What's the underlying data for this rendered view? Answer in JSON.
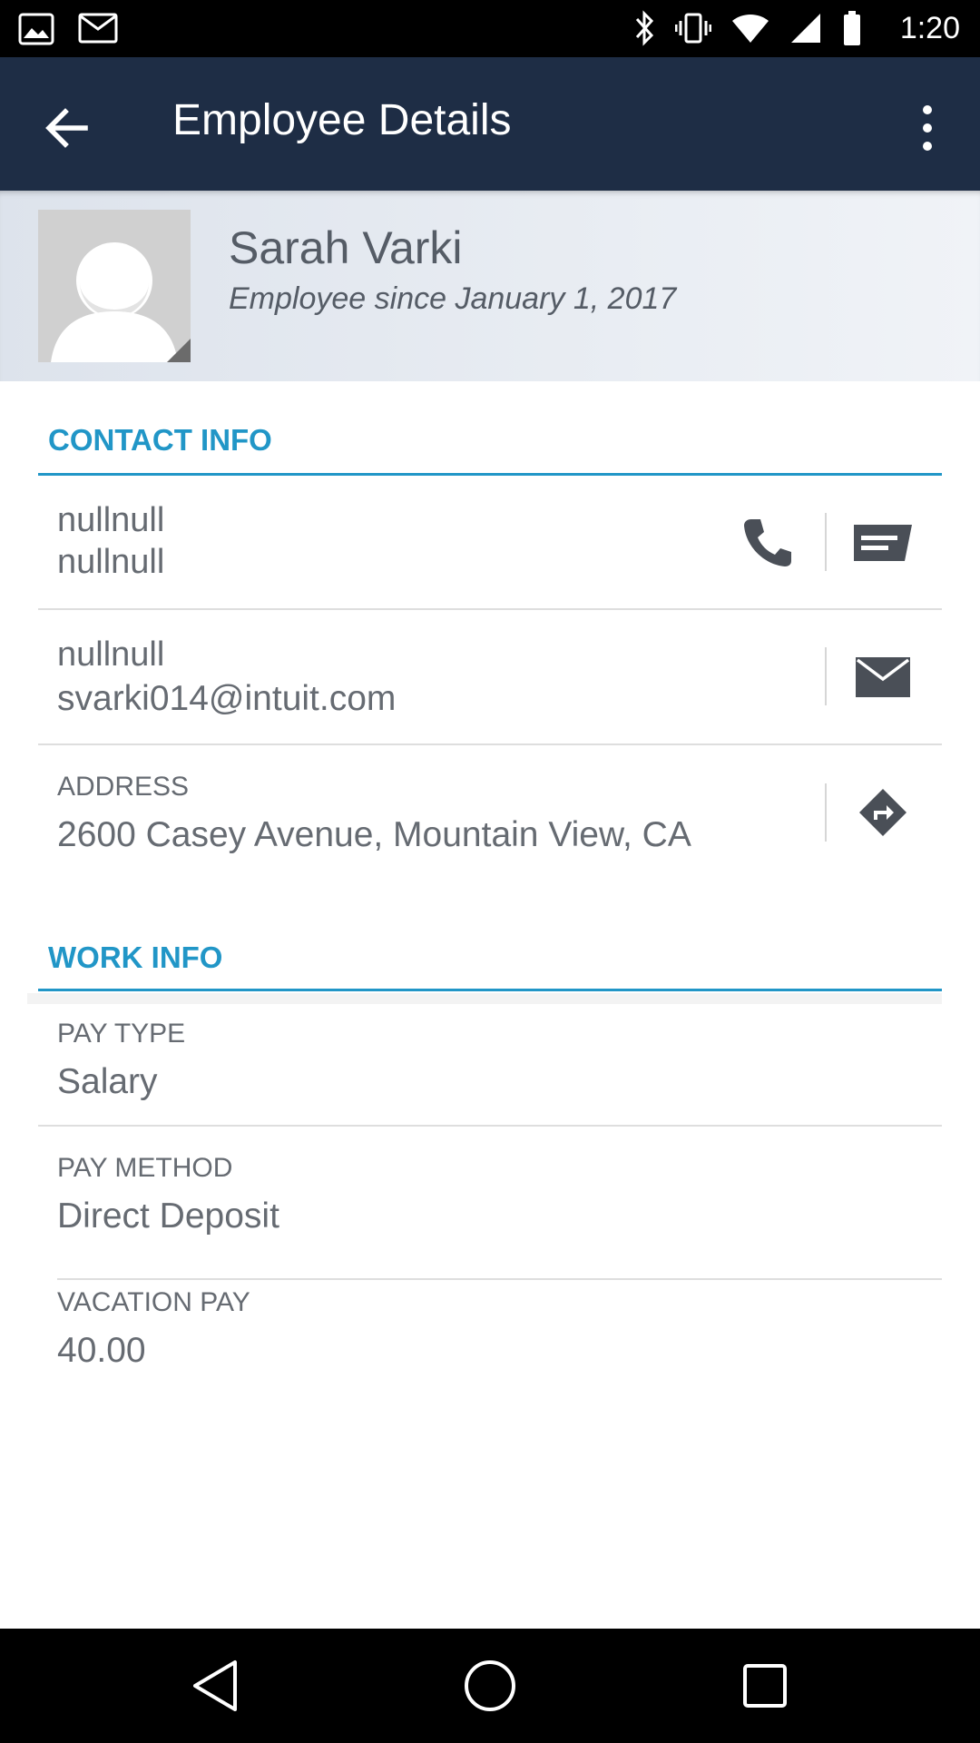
{
  "status_bar": {
    "time": "1:20",
    "icons": [
      "gallery-icon",
      "mail-icon",
      "bluetooth-icon",
      "vibrate-icon",
      "wifi-icon",
      "signal-icon",
      "battery-icon"
    ]
  },
  "app_bar": {
    "title": "Employee Details",
    "back_icon": "arrow-back-icon",
    "overflow_icon": "more-vert-icon"
  },
  "profile": {
    "name": "Sarah Varki",
    "since": "Employee since January 1, 2017"
  },
  "contact_info": {
    "title": "CONTACT INFO",
    "phone": {
      "line1": "nullnull",
      "line2": "nullnull"
    },
    "email": {
      "line1": "nullnull",
      "line2": "svarki014@intuit.com"
    },
    "address": {
      "label": "ADDRESS",
      "value": "2600 Casey Avenue, Mountain View, CA"
    }
  },
  "work_info": {
    "title": "WORK INFO",
    "pay_type": {
      "label": "PAY TYPE",
      "value": "Salary"
    },
    "pay_method": {
      "label": "PAY METHOD",
      "value": "Direct Deposit"
    },
    "vacation_pay": {
      "label": "VACATION PAY",
      "value": "40.00"
    }
  },
  "colors": {
    "app_bar": "#1e2d45",
    "accent": "#2196c7",
    "text_secondary": "#666b72"
  }
}
